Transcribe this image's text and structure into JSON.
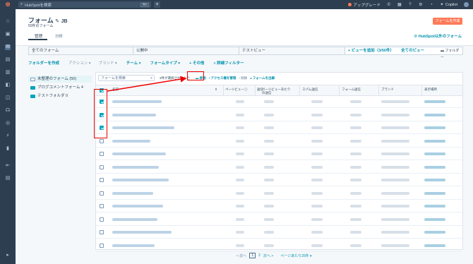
{
  "topbar": {
    "logo": "⊛",
    "search_placeholder": "HubSpotを検索",
    "shortcut": "⌘K",
    "add": "+",
    "upgrade": "アップグレード",
    "copilot": "Copilot"
  },
  "header": {
    "title": "フォーム",
    "title_suffix": "JB",
    "subtitle": "50件のフォーム",
    "create_button": "フォームを作成",
    "tabs": [
      "管理",
      "分析"
    ],
    "external_link": "HubSpot以外のフォーム"
  },
  "views": {
    "tabs": [
      "全てのフォーム",
      "公開中",
      "テストビュー"
    ],
    "add_view": "+ ビューを追加（3/50件）",
    "all_views": "全てのビュー",
    "folder_tab": "フォルダー"
  },
  "filters": {
    "create_folder": "フォルダーを作成",
    "actions": "アクション ▾",
    "brand": "ブランド ▾",
    "team": "チーム ▾",
    "form_type": "フォームタイプ ▾",
    "more": "+ その他",
    "advanced": "詳細フィルター"
  },
  "folders": [
    {
      "label": "未整理のフォーム (50)"
    },
    {
      "label": "ブログコメントフォーム 4"
    },
    {
      "label": "テストフォルダ 0"
    }
  ],
  "table": {
    "search_placeholder": "フォームを検索",
    "bulk": {
      "selected": "3件が選択されました",
      "move": "移動",
      "access": "アクセス権を管理",
      "delete": "削除",
      "export": "フォームを出解"
    },
    "columns": [
      "名前",
      "ページビュー",
      "送信",
      "ページビューあたりの送信",
      "スパム送信",
      "フォーム送信",
      "ブランド",
      "表示場所"
    ]
  },
  "rows": [
    {
      "checked": true
    },
    {
      "checked": true
    },
    {
      "checked": true
    },
    {
      "checked": false
    },
    {
      "checked": false
    },
    {
      "checked": false
    },
    {
      "checked": false
    },
    {
      "checked": false
    },
    {
      "checked": false
    },
    {
      "checked": false
    },
    {
      "checked": false
    },
    {
      "checked": false
    }
  ],
  "pagination": {
    "prev": "< 前へ",
    "page": "1",
    "next_page": "2",
    "next": "次へ >",
    "per_page": "ページあたり25件 ▾"
  },
  "colors": {
    "accent": "#ff7a59",
    "teal": "#00a4bd",
    "link": "#0091ae",
    "nav": "#2d3e50",
    "annotation": "#e00000"
  }
}
